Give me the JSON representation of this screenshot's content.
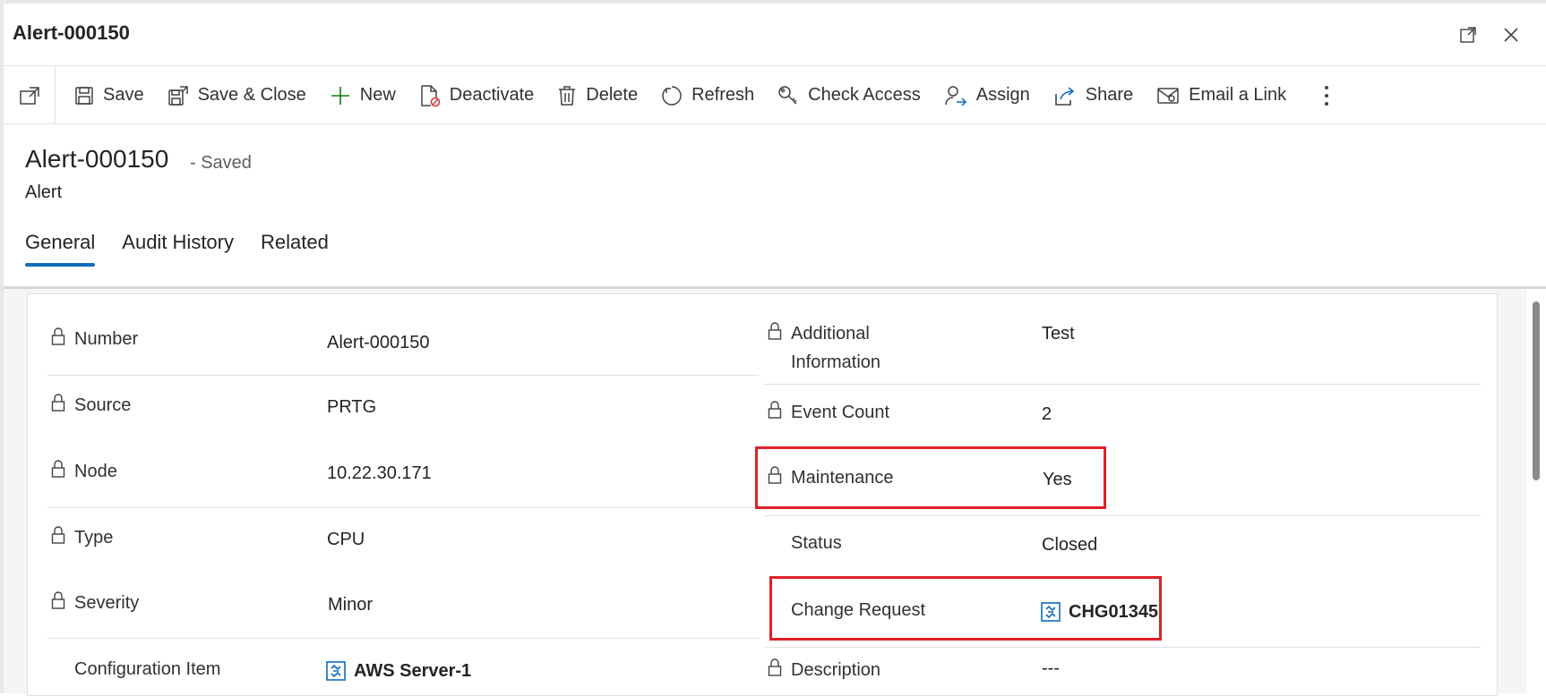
{
  "window": {
    "title": "Alert-000150"
  },
  "toolbar": {
    "items": [
      {
        "label": "Save",
        "icon": "save-icon"
      },
      {
        "label": "Save & Close",
        "icon": "save-close-icon"
      },
      {
        "label": "New",
        "icon": "plus-icon"
      },
      {
        "label": "Deactivate",
        "icon": "deactivate-icon"
      },
      {
        "label": "Delete",
        "icon": "trash-icon"
      },
      {
        "label": "Refresh",
        "icon": "refresh-icon"
      },
      {
        "label": "Check Access",
        "icon": "key-icon"
      },
      {
        "label": "Assign",
        "icon": "assign-icon"
      },
      {
        "label": "Share",
        "icon": "share-icon"
      },
      {
        "label": "Email a Link",
        "icon": "email-icon"
      }
    ]
  },
  "record": {
    "title": "Alert-000150",
    "saved_status": "- Saved",
    "entity": "Alert"
  },
  "tabs": [
    {
      "label": "General",
      "active": true
    },
    {
      "label": "Audit History",
      "active": false
    },
    {
      "label": "Related",
      "active": false
    }
  ],
  "left_fields": [
    {
      "label": "Number",
      "value": "Alert-000150",
      "locked": true
    },
    {
      "label": "Source",
      "value": "PRTG",
      "locked": true
    },
    {
      "label": "Node",
      "value": "10.22.30.171",
      "locked": true
    },
    {
      "label": "Type",
      "value": "CPU",
      "locked": true
    },
    {
      "label": "Severity",
      "value": "Minor",
      "locked": true
    },
    {
      "label": "Configuration Item",
      "value": "AWS Server-1",
      "locked": false,
      "link": true
    }
  ],
  "right_fields": [
    {
      "label_line1": "Additional",
      "label_line2": "Information",
      "value": "Test",
      "locked": true
    },
    {
      "label": "Event Count",
      "value": "2",
      "locked": true
    },
    {
      "label": "Maintenance",
      "value": "Yes",
      "locked": true
    },
    {
      "label": "Status",
      "value": "Closed",
      "locked": false
    },
    {
      "label": "Change Request",
      "value": "CHG01345",
      "locked": false,
      "link": true
    },
    {
      "label": "Description",
      "value": "---",
      "locked": true
    }
  ],
  "colors": {
    "accent": "#0f6cbd",
    "highlight": "#e0202a"
  }
}
